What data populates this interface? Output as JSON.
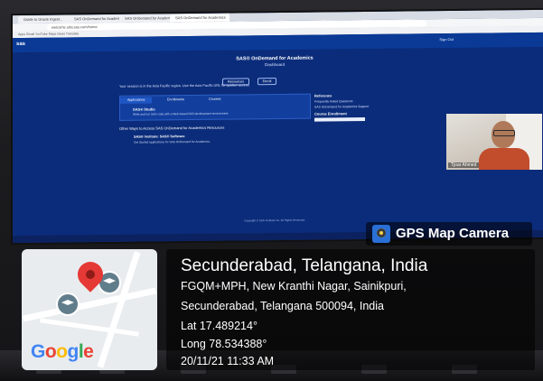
{
  "browser": {
    "tabs": [
      "Guide to Oracle Ingest...",
      "SAS OnDemand for Academics",
      "SAS OnDemand for Academics",
      "SAS OnDemand for Academics"
    ],
    "url": "welcome.oda.sas.com/home",
    "bookmarks": "Apps   Gmail   YouTube   Maps   News   Translate"
  },
  "sas": {
    "logo": "sas",
    "user_menu": "Sign Out",
    "page_title": "SAS® OnDemand for Academics",
    "page_subtitle": "Dashboard",
    "buttons": [
      "Resources",
      "Enroll"
    ],
    "notice": "Your session is in the Asia Pacific region. Use the Asia Pacific URL for quicker access.",
    "tabs": [
      "Applications",
      "Enrollments",
      "Courses"
    ],
    "studio_link": "SAS® Studio",
    "studio_desc": "Write and run SAS code with a Web-based SAS development environment.",
    "side_heading": "Reference",
    "side_links": [
      "Frequently Asked Questions",
      "SAS OnDemand for Academics Support"
    ],
    "side_heading2": "Course Enrollment",
    "other_heading": "Other Ways to Access SAS OnDemand for Academics Resources",
    "other_link": "SAS® Institute: SAS® Software",
    "other_desc": "Get Started applications for SAS OnDemand for Academics.",
    "footer": "Copyright © SAS Institute Inc. All Rights Reserved."
  },
  "webcam": {
    "name": "Tjoar Ahmed"
  },
  "gps": {
    "badge": "GPS Map Camera",
    "city": "Secunderabad, Telangana, India",
    "address_line1": "FGQM+MPH, New Kranthi Nagar, Sainikpuri,",
    "address_line2": "Secunderabad, Telangana 500094, India",
    "lat": "Lat 17.489214°",
    "long": "Long 78.534388°",
    "datetime": "20/11/21 11:33 AM",
    "map_brand": "Google"
  }
}
